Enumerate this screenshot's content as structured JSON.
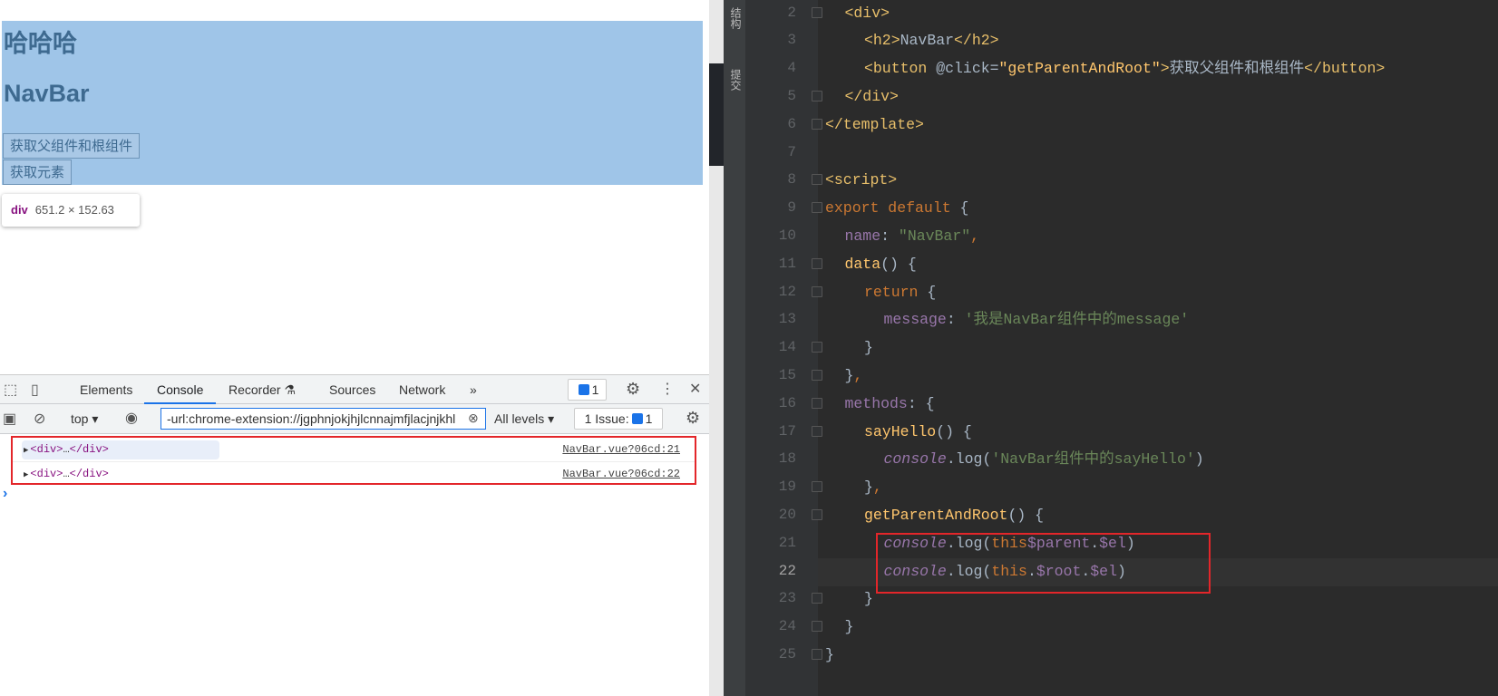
{
  "page": {
    "heading1": "哈哈哈",
    "heading2": "NavBar",
    "buttons": [
      "获取父组件和根组件",
      "获取元素"
    ],
    "tooltip": {
      "tag": "div",
      "size": "651.2 × 152.63"
    },
    "highlight_color": "#9fc5e8"
  },
  "devtools": {
    "tabs": [
      "Elements",
      "Console",
      "Recorder",
      "Sources",
      "Network"
    ],
    "active_tab": "Console",
    "messages_badge": "1",
    "context": "top",
    "filter_value": "-url:chrome-extension://jgphnjokjhjlcnnajmfjlacjnjkhl",
    "levels": "All levels",
    "issues_label": "1 Issue:",
    "issues_count": "1",
    "logs": [
      {
        "open": "<div>",
        "ellipsis": "…",
        "close": "</div>",
        "source": "NavBar.vue?06cd:21"
      },
      {
        "open": "<div>",
        "ellipsis": "…",
        "close": "</div>",
        "source": "NavBar.vue?06cd:22"
      }
    ],
    "prompt": "›"
  },
  "ide": {
    "side_tabs": [
      "结构",
      "提交"
    ],
    "line_numbers": [
      "2",
      "3",
      "4",
      "5",
      "6",
      "7",
      "8",
      "9",
      "10",
      "11",
      "12",
      "13",
      "14",
      "15",
      "16",
      "17",
      "18",
      "19",
      "20",
      "21",
      "22",
      "23",
      "24",
      "25"
    ],
    "current_line": "22",
    "code": {
      "l2": "<div>",
      "l3a": "<h2>",
      "l3b": "NavBar",
      "l3c": "</h2>",
      "l4a": "<button ",
      "l4b": "@click=",
      "l4c": "\"getParentAndRoot\"",
      "l4d": ">",
      "l4e": "获取父组件和根组件",
      "l4f": "</button>",
      "l5": "</div>",
      "l6": "</template>",
      "l8": "<script>",
      "l9a": "export default ",
      "l9b": "{",
      "l10a": "name",
      "l10b": ": ",
      "l10c": "\"NavBar\"",
      "l10d": ",",
      "l11a": "data",
      "l11b": "() {",
      "l12a": "return ",
      "l12b": "{",
      "l13a": "message",
      "l13b": ": ",
      "l13c": "'我是NavBar组件中的message'",
      "l14": "}",
      "l15a": "}",
      "l15b": ",",
      "l16a": "methods",
      "l16b": ": {",
      "l17a": "sayHello",
      "l17b": "() {",
      "l18a": "console",
      "l18b": ".log(",
      "l18c": "'NavBar组件中的sayHello'",
      "l18d": ")",
      "l19a": "}",
      "l19b": ",",
      "l20a": "getParentAndRoot",
      "l20b": "() {",
      "l21a": "console",
      "l21b": ".log(",
      "l21c": "this",
      ".": ".",
      "l21d": "$parent",
      "l21e": ".",
      "l21f": "$el",
      "l21g": ")",
      "l22a": "console",
      "l22b": ".log(",
      "l22c": "this",
      "l22d": ".",
      "l22e": "$root",
      "l22f": ".",
      "l22g": "$el",
      "l22h": ")",
      "l23": "}",
      "l24": "}",
      "l25": "}"
    }
  }
}
